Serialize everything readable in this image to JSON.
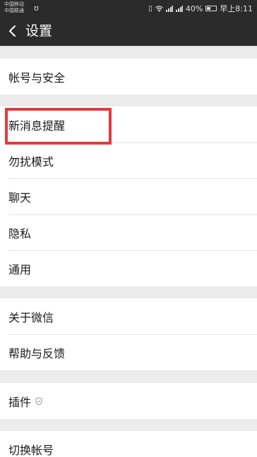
{
  "status_bar": {
    "carrier1": "中国移动",
    "carrier2": "中国联通",
    "battery_percent": "40%",
    "time": "早上8:11",
    "battery_level": 0.4,
    "icons": [
      "usb-icon",
      "vibrate-icon",
      "wifi-icon",
      "signal-icon",
      "signal-icon",
      "battery-icon"
    ]
  },
  "header": {
    "title": "设置",
    "back_icon": "chevron-left-icon"
  },
  "groups": [
    {
      "items": [
        "帐号与安全"
      ]
    },
    {
      "items": [
        "新消息提醒",
        "勿扰模式",
        "聊天",
        "隐私",
        "通用"
      ]
    },
    {
      "items": [
        "关于微信",
        "帮助与反馈"
      ]
    },
    {
      "items": [
        "插件"
      ]
    },
    {
      "items": [
        "切换帐号"
      ]
    }
  ],
  "colors": {
    "header_bg": "#2b2b2b",
    "page_bg": "#ececec",
    "highlight": "#e8383d"
  }
}
